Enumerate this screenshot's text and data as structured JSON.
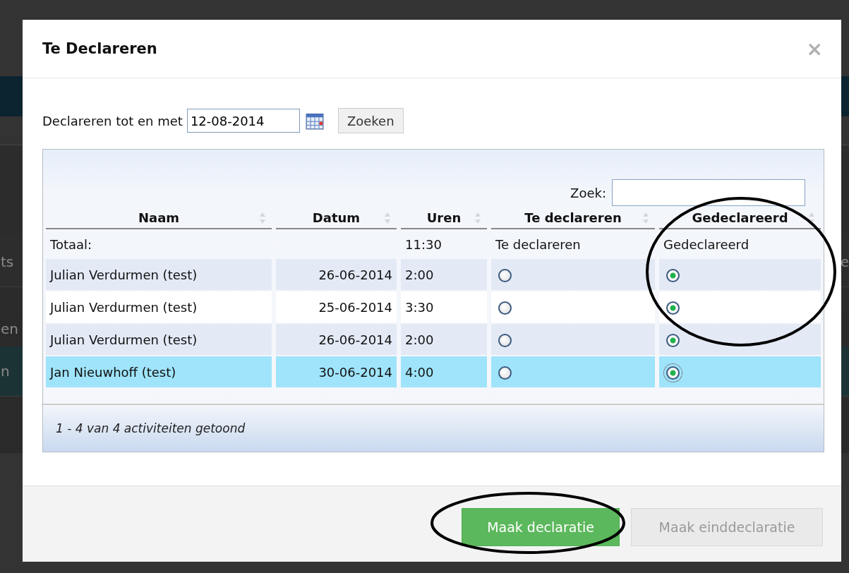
{
  "background_page": {
    "fragments_left": [
      "ts",
      "en",
      "n"
    ],
    "fragments_right": [
      "e"
    ]
  },
  "dialog": {
    "title": "Te Declareren",
    "close": "×",
    "filter": {
      "label": "Declareren tot en met",
      "value": "12-08-2014",
      "button": "Zoeken"
    },
    "table": {
      "search_label": "Zoek:",
      "columns": [
        {
          "label": "Naam"
        },
        {
          "label": "Datum"
        },
        {
          "label": "Uren"
        },
        {
          "label": "Te declareren"
        },
        {
          "label": "Gedeclareerd"
        }
      ],
      "total": {
        "label": "Totaal:",
        "hours": "11:30",
        "option_1": "Te declareren",
        "option_2": "Gedeclareerd"
      },
      "rows": [
        {
          "name": "Julian Verdurmen (test)",
          "date": "26-06-2014",
          "hours": "2:00",
          "te_declareren": false,
          "gedeclareerd": true,
          "selected": false
        },
        {
          "name": "Julian Verdurmen (test)",
          "date": "25-06-2014",
          "hours": "3:30",
          "te_declareren": false,
          "gedeclareerd": true,
          "selected": false
        },
        {
          "name": "Julian Verdurmen (test)",
          "date": "26-06-2014",
          "hours": "2:00",
          "te_declareren": false,
          "gedeclareerd": true,
          "selected": false
        },
        {
          "name": "Jan Nieuwhoff (test)",
          "date": "30-06-2014",
          "hours": "4:00",
          "te_declareren": false,
          "gedeclareerd": true,
          "selected": true
        }
      ],
      "info": "1 - 4 van 4 activiteiten getoond"
    },
    "buttons": [
      {
        "label": "Maak declaratie",
        "disabled": false
      },
      {
        "label": "Maak einddeclaratie",
        "disabled": true
      }
    ]
  },
  "annotations": [
    {
      "kind": "ellipse"
    },
    {
      "kind": "ellipse"
    }
  ]
}
